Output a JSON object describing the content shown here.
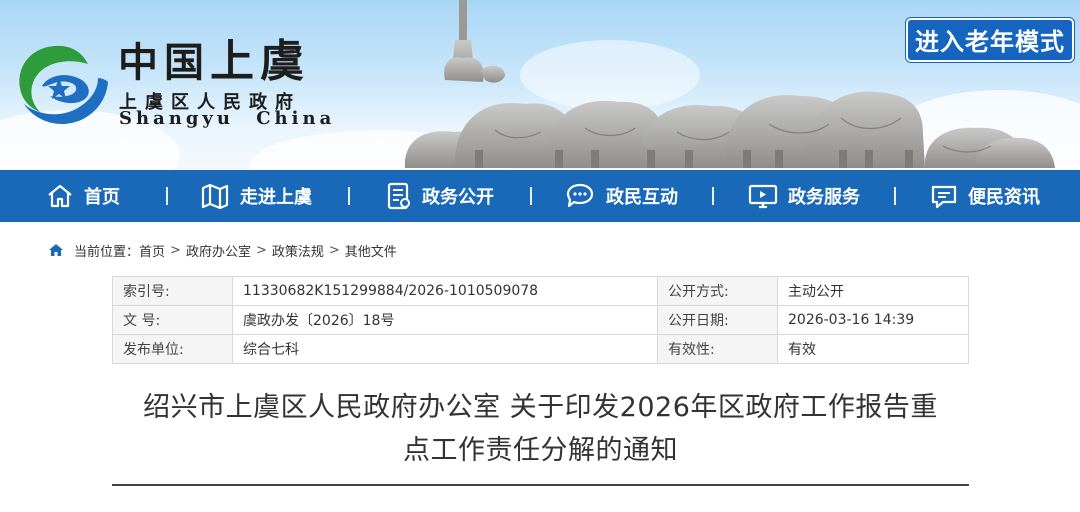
{
  "header": {
    "logo_title": "中国上虞",
    "logo_title_a": "中国",
    "logo_title_b": "上虞",
    "subtitle_cn": "上虞区人民政府",
    "subtitle_en": "Shangyu China",
    "elder_mode_label": "进入老年模式"
  },
  "nav": {
    "items": [
      {
        "label": "首页",
        "icon": "home-icon"
      },
      {
        "label": "走进上虞",
        "icon": "map-icon"
      },
      {
        "label": "政务公开",
        "icon": "document-icon"
      },
      {
        "label": "政民互动",
        "icon": "chat-icon"
      },
      {
        "label": "政务服务",
        "icon": "monitor-icon"
      },
      {
        "label": "便民资讯",
        "icon": "message-icon"
      }
    ]
  },
  "breadcrumb": {
    "prefix": "当前位置：",
    "items": [
      "首页",
      "政府办公室",
      "政策法规",
      "其他文件"
    ],
    "separator": ">"
  },
  "meta": {
    "rows": [
      {
        "k1": "索引号:",
        "v1": "11330682K151299884/2026-1010509078",
        "k2": "公开方式:",
        "v2": "主动公开"
      },
      {
        "k1": "文 号:",
        "v1": "虞政办发〔2026〕18号",
        "k2": "公开日期:",
        "v2": "2026-03-16 14:39"
      },
      {
        "k1": "发布单位:",
        "v1": "综合七科",
        "k2": "有效性:",
        "v2": "有效"
      }
    ]
  },
  "article": {
    "title_line1": "绍兴市上虞区人民政府办公室 关于印发2026年区政府工作报告重",
    "title_line2": "点工作责任分解的通知"
  },
  "colors": {
    "nav_bg": "#1a68b8",
    "elder_btn_bg": "#1565c0",
    "logo_green": "#2e9c3a",
    "logo_blue": "#1e6fc1"
  }
}
